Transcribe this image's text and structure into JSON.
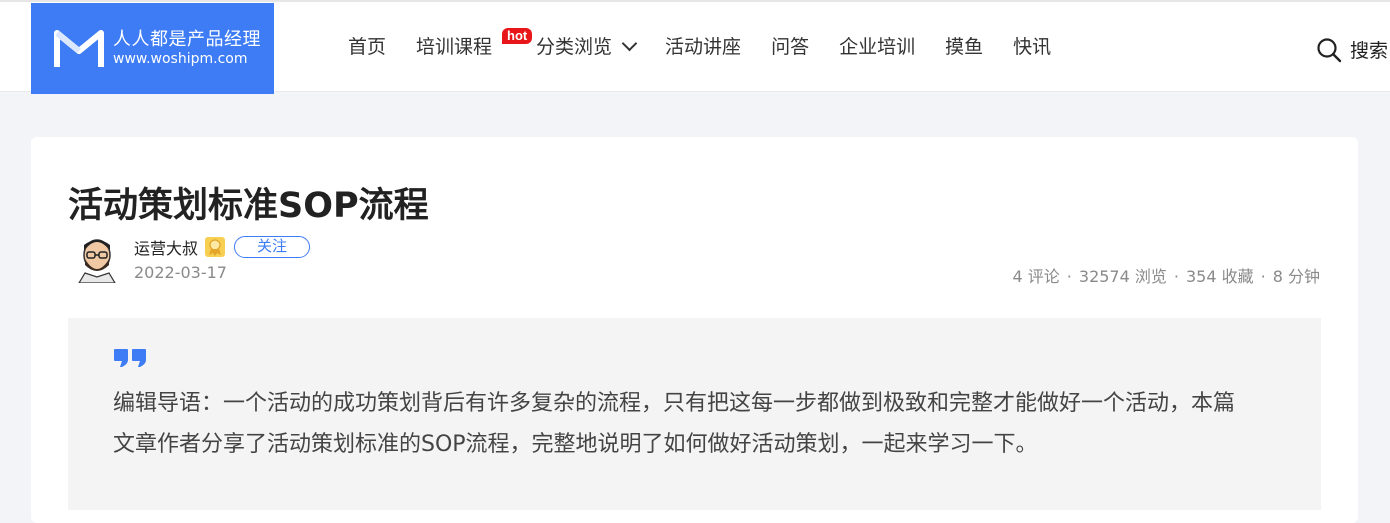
{
  "header": {
    "logo": {
      "name_cn": "人人都是产品经理",
      "domain": "www.woshipm.com"
    },
    "nav": [
      {
        "label": "首页"
      },
      {
        "label": "培训课程",
        "badge": "hot"
      },
      {
        "label": "分类浏览",
        "dropdown": true
      },
      {
        "label": "活动讲座"
      },
      {
        "label": "问答"
      },
      {
        "label": "企业培训"
      },
      {
        "label": "摸鱼"
      },
      {
        "label": "快讯"
      }
    ],
    "search_label": "搜索"
  },
  "article": {
    "title": "活动策划标准SOP流程",
    "author": {
      "name": "运营大叔",
      "follow_label": "关注"
    },
    "date": "2022-03-17",
    "stats": {
      "comments": "4 评论",
      "views": "32574 浏览",
      "favorites": "354 收藏",
      "read_time": "8 分钟"
    },
    "intro": "编辑导语：一个活动的成功策划背后有许多复杂的流程，只有把这每一步都做到极致和完整才能做好一个活动，本篇文章作者分享了活动策划标准的SOP流程，完整地说明了如何做好活动策划，一起来学习一下。"
  },
  "colors": {
    "brand": "#3d7cf5",
    "hot": "#e8161b"
  }
}
